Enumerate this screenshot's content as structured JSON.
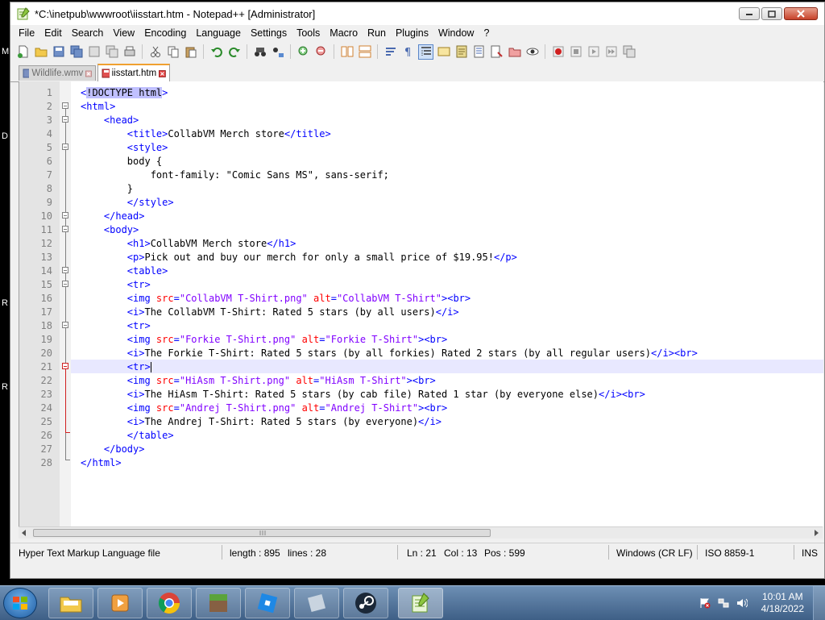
{
  "window": {
    "title": "*C:\\inetpub\\wwwroot\\iisstart.htm - Notepad++ [Administrator]"
  },
  "menu": [
    "File",
    "Edit",
    "Search",
    "View",
    "Encoding",
    "Language",
    "Settings",
    "Tools",
    "Macro",
    "Run",
    "Plugins",
    "Window",
    "?"
  ],
  "tabs": [
    {
      "label": "Wildlife.wmv",
      "active": false
    },
    {
      "label": "iisstart.htm",
      "active": true
    }
  ],
  "editor": {
    "current_line": 21,
    "lines": [
      {
        "n": "1",
        "parts": [
          [
            "tag",
            "<"
          ],
          [
            "hl",
            "!DOCTYPE html"
          ],
          [
            "tag",
            ">"
          ]
        ]
      },
      {
        "n": "2",
        "parts": [
          [
            "tag",
            "<html>"
          ]
        ]
      },
      {
        "n": "3",
        "parts": [
          [
            "txt",
            "    "
          ],
          [
            "tag",
            "<head>"
          ]
        ]
      },
      {
        "n": "4",
        "parts": [
          [
            "txt",
            "        "
          ],
          [
            "tag",
            "<title>"
          ],
          [
            "txt",
            "CollabVM Merch store"
          ],
          [
            "tag",
            "</title>"
          ]
        ]
      },
      {
        "n": "5",
        "parts": [
          [
            "txt",
            "        "
          ],
          [
            "tag",
            "<style>"
          ]
        ]
      },
      {
        "n": "6",
        "parts": [
          [
            "txt",
            "        body {"
          ]
        ]
      },
      {
        "n": "7",
        "parts": [
          [
            "txt",
            "            font-family: \"Comic Sans MS\", sans-serif;"
          ]
        ]
      },
      {
        "n": "8",
        "parts": [
          [
            "txt",
            "        }"
          ]
        ]
      },
      {
        "n": "9",
        "parts": [
          [
            "txt",
            "        "
          ],
          [
            "tag",
            "</style>"
          ]
        ]
      },
      {
        "n": "10",
        "parts": [
          [
            "txt",
            "    "
          ],
          [
            "tag",
            "</head>"
          ]
        ]
      },
      {
        "n": "11",
        "parts": [
          [
            "txt",
            "    "
          ],
          [
            "tag",
            "<body>"
          ]
        ]
      },
      {
        "n": "12",
        "parts": [
          [
            "txt",
            "        "
          ],
          [
            "tag",
            "<h1>"
          ],
          [
            "txt",
            "CollabVM Merch store"
          ],
          [
            "tag",
            "</h1>"
          ]
        ]
      },
      {
        "n": "13",
        "parts": [
          [
            "txt",
            "        "
          ],
          [
            "tag",
            "<p>"
          ],
          [
            "txt",
            "Pick out and buy our merch for only a small price of $19.95!"
          ],
          [
            "tag",
            "</p>"
          ]
        ]
      },
      {
        "n": "14",
        "parts": [
          [
            "txt",
            "        "
          ],
          [
            "tag",
            "<table>"
          ]
        ]
      },
      {
        "n": "15",
        "parts": [
          [
            "txt",
            "        "
          ],
          [
            "tag",
            "<tr>"
          ]
        ]
      },
      {
        "n": "16",
        "parts": [
          [
            "txt",
            "        "
          ],
          [
            "tag",
            "<img "
          ],
          [
            "attr",
            "src"
          ],
          [
            "tag",
            "="
          ],
          [
            "val",
            "\"CollabVM T-Shirt.png\""
          ],
          [
            "txt",
            " "
          ],
          [
            "attr",
            "alt"
          ],
          [
            "tag",
            "="
          ],
          [
            "val",
            "\"CollabVM T-Shirt\""
          ],
          [
            "tag",
            "><br>"
          ]
        ]
      },
      {
        "n": "17",
        "parts": [
          [
            "txt",
            "        "
          ],
          [
            "tag",
            "<i>"
          ],
          [
            "txt",
            "The CollabVM T-Shirt: Rated 5 stars (by all users)"
          ],
          [
            "tag",
            "</i>"
          ]
        ]
      },
      {
        "n": "18",
        "parts": [
          [
            "txt",
            "        "
          ],
          [
            "tag",
            "<tr>"
          ]
        ]
      },
      {
        "n": "19",
        "parts": [
          [
            "txt",
            "        "
          ],
          [
            "tag",
            "<img "
          ],
          [
            "attr",
            "src"
          ],
          [
            "tag",
            "="
          ],
          [
            "val",
            "\"Forkie T-Shirt.png\""
          ],
          [
            "txt",
            " "
          ],
          [
            "attr",
            "alt"
          ],
          [
            "tag",
            "="
          ],
          [
            "val",
            "\"Forkie T-Shirt\""
          ],
          [
            "tag",
            "><br>"
          ]
        ]
      },
      {
        "n": "20",
        "parts": [
          [
            "txt",
            "        "
          ],
          [
            "tag",
            "<i>"
          ],
          [
            "txt",
            "The Forkie T-Shirt: Rated 5 stars (by all forkies) Rated 2 stars (by all regular users)"
          ],
          [
            "tag",
            "</i><br>"
          ]
        ]
      },
      {
        "n": "21",
        "parts": [
          [
            "txt",
            "        "
          ],
          [
            "tag",
            "<tr>"
          ]
        ]
      },
      {
        "n": "22",
        "parts": [
          [
            "txt",
            "        "
          ],
          [
            "tag",
            "<img "
          ],
          [
            "attr",
            "src"
          ],
          [
            "tag",
            "="
          ],
          [
            "val",
            "\"HiAsm T-Shirt.png\""
          ],
          [
            "txt",
            " "
          ],
          [
            "attr",
            "alt"
          ],
          [
            "tag",
            "="
          ],
          [
            "val",
            "\"HiAsm T-Shirt\""
          ],
          [
            "tag",
            "><br>"
          ]
        ]
      },
      {
        "n": "23",
        "parts": [
          [
            "txt",
            "        "
          ],
          [
            "tag",
            "<i>"
          ],
          [
            "txt",
            "The HiAsm T-Shirt: Rated 5 stars (by cab file) Rated 1 star (by everyone else)"
          ],
          [
            "tag",
            "</i><br>"
          ]
        ]
      },
      {
        "n": "24",
        "parts": [
          [
            "txt",
            "        "
          ],
          [
            "tag",
            "<img "
          ],
          [
            "attr",
            "src"
          ],
          [
            "tag",
            "="
          ],
          [
            "val",
            "\"Andrej T-Shirt.png\""
          ],
          [
            "txt",
            " "
          ],
          [
            "attr",
            "alt"
          ],
          [
            "tag",
            "="
          ],
          [
            "val",
            "\"Andrej T-Shirt\""
          ],
          [
            "tag",
            "><br>"
          ]
        ]
      },
      {
        "n": "25",
        "parts": [
          [
            "txt",
            "        "
          ],
          [
            "tag",
            "<i>"
          ],
          [
            "txt",
            "The Andrej T-Shirt: Rated 5 stars (by everyone)"
          ],
          [
            "tag",
            "</i>"
          ]
        ]
      },
      {
        "n": "26",
        "parts": [
          [
            "txt",
            "        "
          ],
          [
            "tag",
            "</table>"
          ]
        ]
      },
      {
        "n": "27",
        "parts": [
          [
            "txt",
            "    "
          ],
          [
            "tag",
            "</body>"
          ]
        ]
      },
      {
        "n": "28",
        "parts": [
          [
            "tag",
            "</html>"
          ]
        ]
      }
    ]
  },
  "status": {
    "file_type": "Hyper Text Markup Language file",
    "length": "length : 895",
    "lines": "lines : 28",
    "ln": "Ln : 21",
    "col": "Col : 13",
    "pos": "Pos : 599",
    "eol": "Windows (CR LF)",
    "encoding": "ISO 8859-1",
    "mode": "INS"
  },
  "taskbar": {
    "apps": [
      "file-explorer",
      "media-player",
      "chrome",
      "minecraft",
      "roblox",
      "blank-app",
      "steam",
      "notepad-plus-plus"
    ],
    "time": "10:01 AM",
    "date": "4/18/2022"
  },
  "desktop_letters": [
    "M",
    "D",
    "R",
    "R"
  ],
  "colors": {
    "tag": "#0000ff",
    "attr": "#ff0000",
    "value": "#8000ff",
    "current_line": "#e8e8ff"
  }
}
